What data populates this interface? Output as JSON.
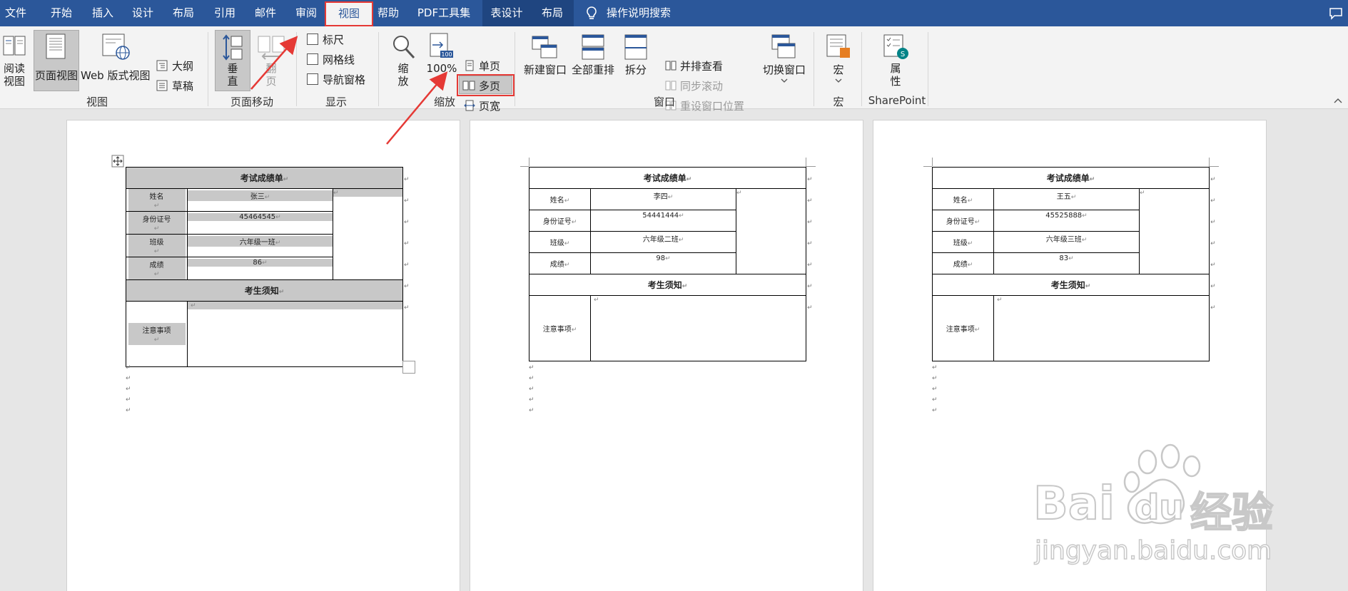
{
  "tabs": [
    {
      "label": "文件",
      "active": false
    },
    {
      "label": "开始",
      "active": false
    },
    {
      "label": "插入",
      "active": false
    },
    {
      "label": "设计",
      "active": false
    },
    {
      "label": "布局",
      "active": false
    },
    {
      "label": "引用",
      "active": false
    },
    {
      "label": "邮件",
      "active": false
    },
    {
      "label": "审阅",
      "active": false
    },
    {
      "label": "视图",
      "active": true
    },
    {
      "label": "帮助",
      "active": false
    },
    {
      "label": "PDF工具集",
      "active": false
    },
    {
      "label": "表设计",
      "active": false,
      "contextual": true
    },
    {
      "label": "布局",
      "active": false,
      "contextual": true
    }
  ],
  "search": {
    "label": "操作说明搜索",
    "icon": "lightbulb-icon"
  },
  "ribbon": {
    "views": {
      "read_mode": [
        "阅读",
        "视图"
      ],
      "print_layout": "页面视图",
      "web_layout": "Web 版式视图",
      "outline": "大纲",
      "draft": "草稿",
      "group": "视图"
    },
    "page_movement": {
      "vertical": [
        "垂",
        "直"
      ],
      "side_to_side": [
        "翻",
        "页"
      ],
      "group": "页面移动"
    },
    "show": {
      "ruler": {
        "label": "标尺",
        "checked": false
      },
      "gridlines": {
        "label": "网格线",
        "checked": false
      },
      "navigation_pane": {
        "label": "导航窗格",
        "checked": false
      },
      "group": "显示"
    },
    "zoom": {
      "zoom": [
        "缩",
        "放"
      ],
      "hundred": "100%",
      "one_page": "单页",
      "multiple_pages": "多页",
      "page_width": "页宽",
      "group": "缩放"
    },
    "window": {
      "new_window": "新建窗口",
      "arrange_all": "全部重排",
      "split": "拆分",
      "side_by_side": "并排查看",
      "sync_scroll": "同步滚动",
      "reset_position": "重设窗口位置",
      "switch_windows": "切换窗口",
      "group": "窗口"
    },
    "macros": {
      "label": "宏",
      "group": "宏"
    },
    "sharepoint": {
      "properties": [
        "属",
        "性"
      ],
      "group": "SharePoint"
    }
  },
  "pages": [
    {
      "title": "考试成绩单",
      "labels": [
        "姓名",
        "身份证号",
        "班级",
        "成绩"
      ],
      "values": [
        "张三",
        "45464545",
        "六年级一班",
        "86"
      ],
      "notice_title": "考生须知",
      "notice_label": "注意事项",
      "shaded": true
    },
    {
      "title": "考试成绩单",
      "labels": [
        "姓名",
        "身份证号",
        "班级",
        "成绩"
      ],
      "values": [
        "李四",
        "54441444",
        "六年级二班",
        "98"
      ],
      "notice_title": "考生须知",
      "notice_label": "注意事项",
      "shaded": false
    },
    {
      "title": "考试成绩单",
      "labels": [
        "姓名",
        "身份证号",
        "班级",
        "成绩"
      ],
      "values": [
        "王五",
        "45525888",
        "六年级三班",
        "83"
      ],
      "notice_title": "考生须知",
      "notice_label": "注意事项",
      "shaded": false
    }
  ],
  "paragraph_mark": "↵",
  "watermark": {
    "brand": "Bai",
    "du": "du",
    "cn": "经验",
    "url": "jingyan.baidu.com"
  },
  "colors": {
    "tabbar": "#2b579a",
    "highlight": "#e53935",
    "shade": "#c8c8c8"
  }
}
